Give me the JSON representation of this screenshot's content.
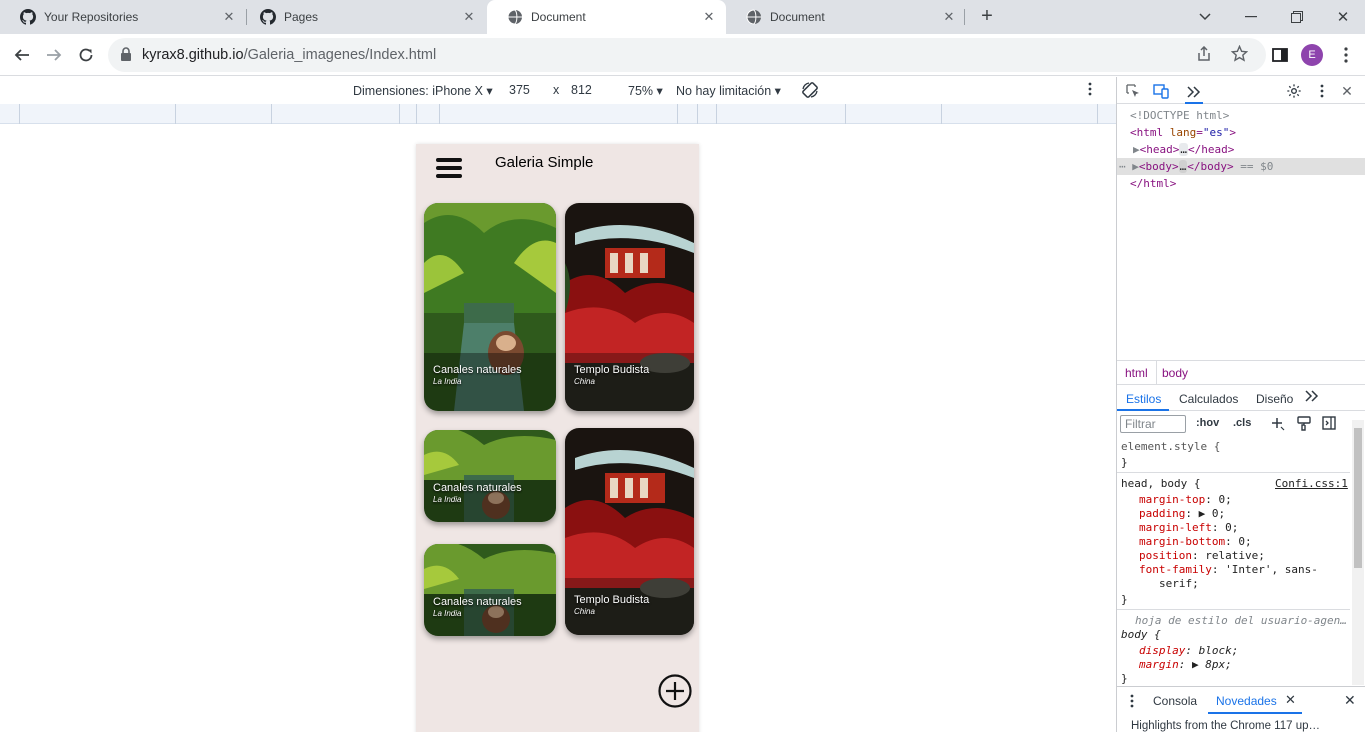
{
  "tabs": [
    {
      "title": "Your Repositories",
      "icon": "github-icon"
    },
    {
      "title": "Pages",
      "icon": "github-icon"
    },
    {
      "title": "Document",
      "icon": "globe-icon",
      "active": true
    },
    {
      "title": "Document",
      "icon": "globe-icon"
    }
  ],
  "toolbar": {
    "url_host": "kyrax8.github.io",
    "url_path": "/Galeria_imagenes/Index.html",
    "avatar_letter": "E"
  },
  "device_toolbar": {
    "dimensions_label": "Dimensiones: iPhone X",
    "width": "375",
    "times": "x",
    "height": "812",
    "zoom": "75%",
    "throttle": "No hay limitación"
  },
  "app": {
    "title": "Galeria Simple",
    "cards": [
      {
        "title": "Canales naturales",
        "subtitle": "La India",
        "kind": "canal"
      },
      {
        "title": "Templo Budista",
        "subtitle": "China",
        "kind": "temple"
      },
      {
        "title": "Canales naturales",
        "subtitle": "La India",
        "kind": "canal"
      },
      {
        "title": "Templo Budista",
        "subtitle": "China",
        "kind": "temple"
      },
      {
        "title": "Canales naturales",
        "subtitle": "La India",
        "kind": "canal"
      }
    ]
  },
  "devtools": {
    "dom": {
      "doctype": "<!DOCTYPE html>",
      "html_open_tag": "<html",
      "html_attr": "lang",
      "html_val": "\"es\"",
      "html_close": ">",
      "head_open": "<head>",
      "head_close": "</head>",
      "body_open": "<body>",
      "body_close": "</body>",
      "ellipsis": "…",
      "selected_marker": "== $0",
      "html_end": "</html>"
    },
    "breadcrumbs": [
      "html",
      "body"
    ],
    "subtabs": [
      "Estilos",
      "Calculados",
      "Diseño"
    ],
    "filter_placeholder": "Filtrar",
    "hov": ":hov",
    "cls": ".cls",
    "styles": {
      "element_style": "element.style {",
      "close": "}",
      "rule_selector": "head, body {",
      "rule_source": "Confi.css:1",
      "props": [
        {
          "name": "margin-top",
          "value": "0;"
        },
        {
          "name": "padding",
          "value": "▶ 0;"
        },
        {
          "name": "margin-left",
          "value": "0;"
        },
        {
          "name": "margin-bottom",
          "value": "0;"
        },
        {
          "name": "position",
          "value": "relative;"
        },
        {
          "name": "font-family",
          "value": "'Inter', sans-"
        },
        {
          "name": "",
          "value": "serif;"
        }
      ],
      "ua_header": "hoja de estilo del usuario-agen…",
      "ua_selector": "body {",
      "ua_props": [
        {
          "name": "display",
          "value": "block;"
        },
        {
          "name": "margin",
          "value": "▶ 8px;"
        }
      ]
    },
    "drawer": {
      "tab1": "Consola",
      "tab2": "Novedades",
      "body_text": "Highlights from the Chrome 117 up…"
    }
  },
  "colors": {
    "accent": "#1a73e8",
    "phone_bg": "#efe6e4",
    "tag": "#881280"
  }
}
